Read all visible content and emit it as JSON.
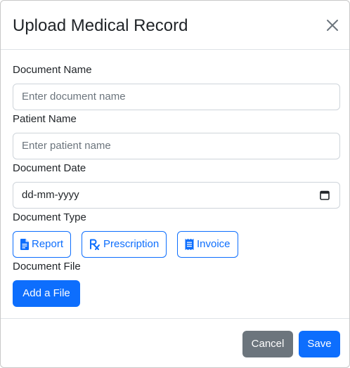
{
  "modal": {
    "title": "Upload Medical Record",
    "close_icon": "close-icon"
  },
  "form": {
    "document_name": {
      "label": "Document Name",
      "placeholder": "Enter document name",
      "value": ""
    },
    "patient_name": {
      "label": "Patient Name",
      "placeholder": "Enter patient name",
      "value": ""
    },
    "document_date": {
      "label": "Document Date",
      "value": "dd-mm-yyyy",
      "icon": "calendar-icon"
    },
    "document_type": {
      "label": "Document Type",
      "options": [
        {
          "label": "Report",
          "icon": "document-icon"
        },
        {
          "label": "Prescription",
          "icon": "prescription-icon"
        },
        {
          "label": "Invoice",
          "icon": "receipt-icon"
        }
      ]
    },
    "document_file": {
      "label": "Document File",
      "button_label": "Add a File"
    }
  },
  "footer": {
    "cancel_label": "Cancel",
    "save_label": "Save"
  },
  "colors": {
    "primary": "#0d6efd",
    "secondary": "#6c757d",
    "border": "#ced4da",
    "divider": "#dee2e6"
  }
}
